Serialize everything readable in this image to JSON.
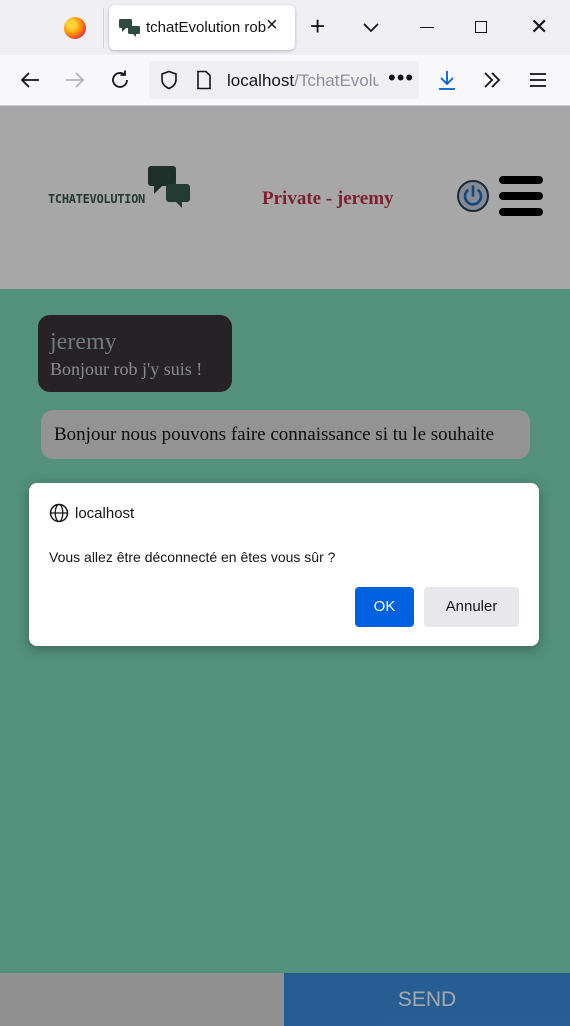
{
  "browser": {
    "tab_title": "tchatEvolution rob",
    "url_host": "localhost",
    "url_path": "/TchatEvolu",
    "url_more": "•••"
  },
  "header": {
    "logo_text": "TCHATEVOLUTION",
    "private_label": "Private - jeremy",
    "accent_color": "#c0314a"
  },
  "chat": {
    "messages": [
      {
        "author": "jeremy",
        "text": "Bonjour rob j'y suis !"
      },
      {
        "author": "",
        "text": "Bonjour nous pouvons faire connaissance si tu le souhaite"
      }
    ],
    "background_color": "#7fdcbd"
  },
  "footer": {
    "message_value": "",
    "send_label": "SEND"
  },
  "dialog": {
    "origin": "localhost",
    "message": "Vous allez être déconnecté en êtes vous sûr ?",
    "ok_label": "OK",
    "cancel_label": "Annuler"
  },
  "icons": {
    "firefox": "firefox-logo-icon",
    "back": "back-arrow-icon",
    "forward": "forward-arrow-icon",
    "reload": "reload-icon",
    "shield": "tracking-shield-icon",
    "page": "page-icon",
    "download": "download-icon",
    "overflow": "chevron-double-right-icon",
    "menu": "hamburger-menu-icon",
    "power": "power-icon",
    "globe": "globe-icon"
  }
}
